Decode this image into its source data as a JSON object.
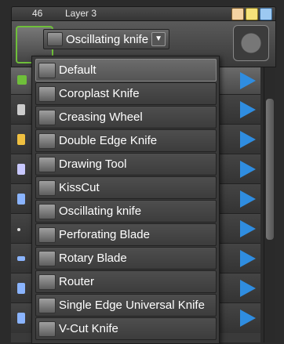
{
  "layer": {
    "number": "46",
    "name": "Layer 3"
  },
  "tool": {
    "selected": "Oscillating knife"
  },
  "menu": {
    "options": [
      "Default",
      "Coroplast Knife",
      "Creasing Wheel",
      "Double Edge Knife",
      "Drawing Tool",
      "KissCut",
      "Oscillating knife",
      "Perforating Blade",
      "Rotary Blade",
      "Router",
      "Single Edge Universal Knife",
      "V-Cut Knife"
    ],
    "highlighted_index": 0
  },
  "colors": {
    "accent_arrow": "#2f8de0",
    "active_border": "#6fbf3a"
  }
}
